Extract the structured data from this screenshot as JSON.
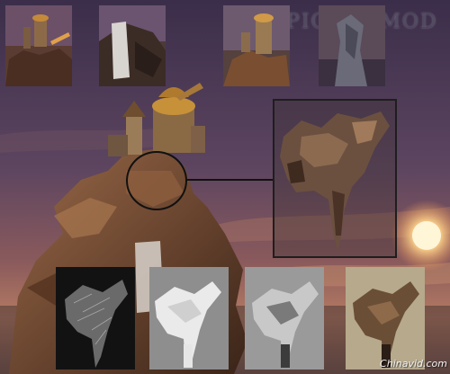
{
  "title": "EPIC 3班 MOD",
  "watermark": "Chinavid.com",
  "thumbnails": [
    {
      "icon": "castle-on-rock-thumbnail",
      "background": "#5a3c32"
    },
    {
      "icon": "waterfall-rock-thumbnail",
      "background": "#4c3a3a"
    },
    {
      "icon": "tower-on-rock-thumbnail",
      "background": "#55413d"
    },
    {
      "icon": "rock-pillar-thumbnail",
      "background": "#5b4a58"
    }
  ],
  "detail_stages": [
    {
      "icon": "wireframe-rock-model",
      "style": "wireframe"
    },
    {
      "icon": "white-clay-rock-model",
      "style": "clay"
    },
    {
      "icon": "grey-shaded-rock-model",
      "style": "shaded"
    },
    {
      "icon": "textured-rock-model",
      "style": "textured"
    }
  ],
  "colors": {
    "sky_top": "#3a2d4a",
    "sky_mid": "#7a5560",
    "sunset": "#e8b770",
    "rock": "#6b4630",
    "rock_dark": "#3a2418",
    "sun": "#fff6d8"
  }
}
